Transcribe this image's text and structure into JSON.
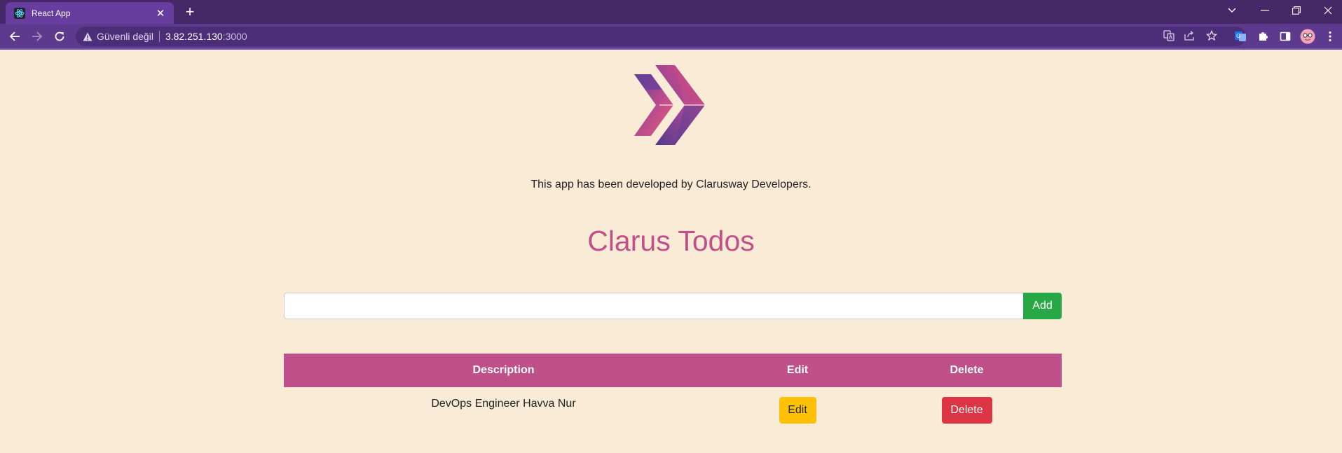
{
  "browser": {
    "tab_title": "React App",
    "security_label": "Güvenli değil",
    "url_host": "3.82.251.130",
    "url_port": ":3000"
  },
  "colors": {
    "page_bg": "#faebd7",
    "accent": "#c0508a",
    "add_button": "#28a745",
    "edit_button": "#ffc107",
    "delete_button": "#dc3545"
  },
  "page": {
    "credit": "This app has been developed by Clarusway Developers.",
    "heading": "Clarus Todos",
    "input_value": "",
    "add_label": "Add"
  },
  "table": {
    "headers": [
      "Description",
      "Edit",
      "Delete"
    ],
    "rows": [
      {
        "description": "DevOps Engineer Havva Nur",
        "edit_label": "Edit",
        "delete_label": "Delete"
      }
    ]
  }
}
